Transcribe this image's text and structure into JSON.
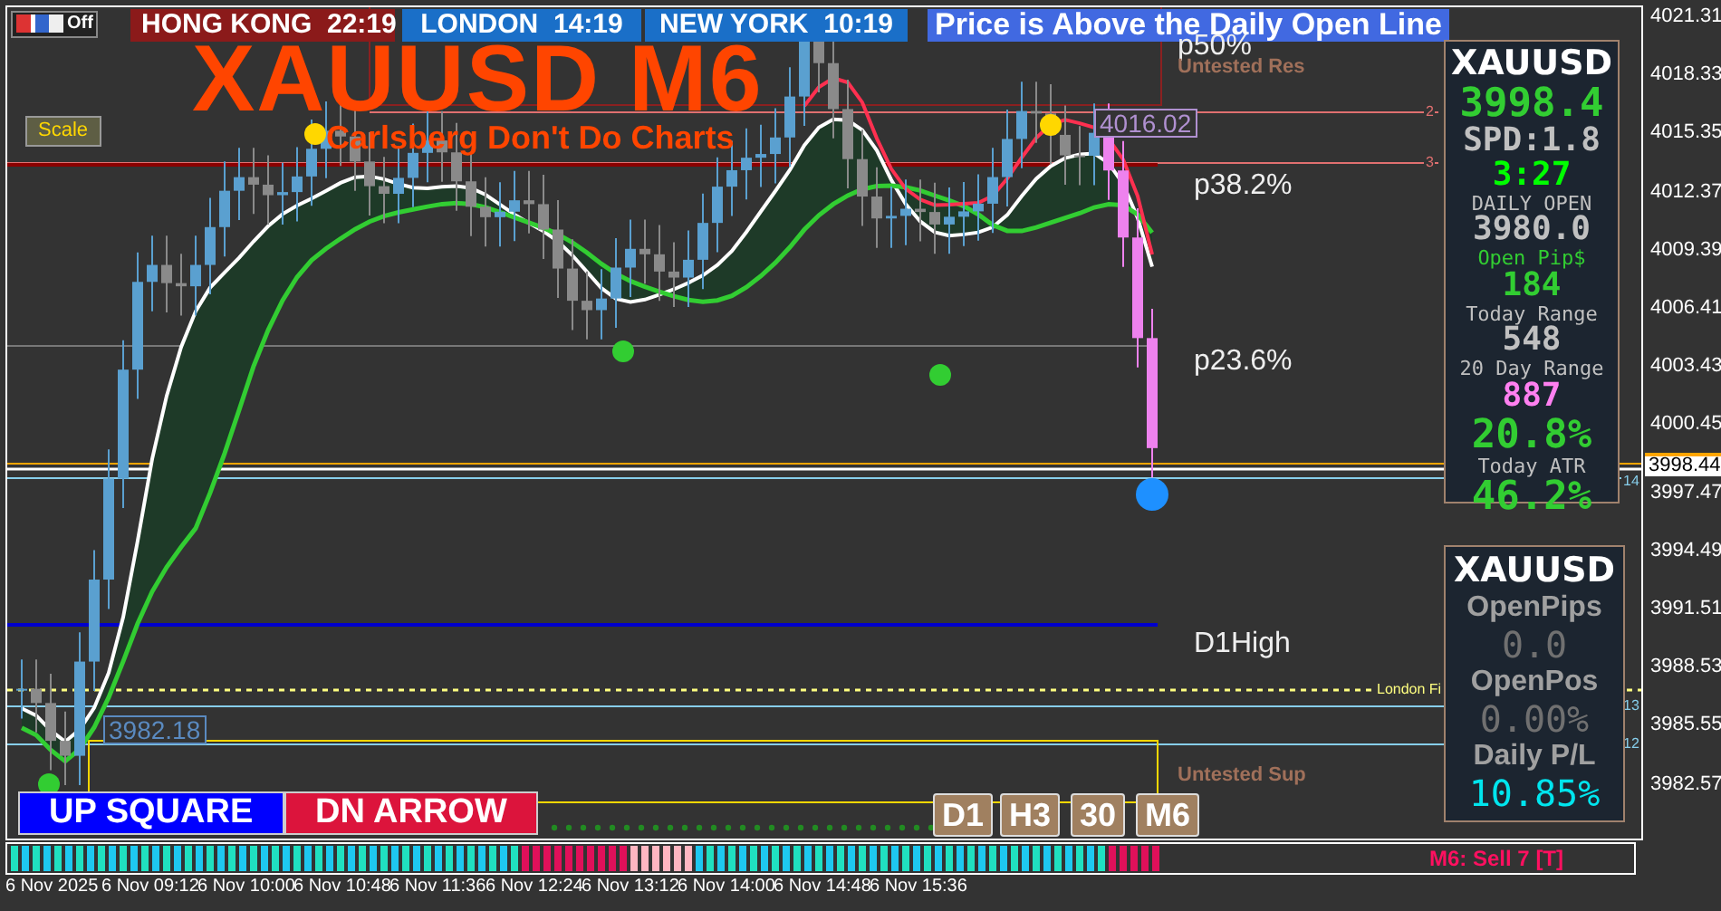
{
  "toolbar": {
    "label": "Off"
  },
  "clocks": [
    {
      "city": "HONG KONG",
      "time": "22:19",
      "color": "#8b1a1a"
    },
    {
      "city": "LONDON",
      "time": "14:19",
      "color": "#1a6fc8"
    },
    {
      "city": "NEW YORK",
      "time": "10:19",
      "color": "#1a6fc8"
    }
  ],
  "alert": "Price is Above the Daily Open Line",
  "chart": {
    "title": "XAUUSD M6",
    "subtitle": "Carlsberg Don't Do Charts",
    "scale_button": "Scale",
    "levels": [
      {
        "label": "p50%",
        "kind": "fib"
      },
      {
        "label": "Untested Res",
        "kind": "zone"
      },
      {
        "label": "p38.2%",
        "kind": "fib"
      },
      {
        "label": "p23.6%",
        "kind": "fib"
      },
      {
        "label": "D1High",
        "kind": "fib"
      },
      {
        "label": "Untested Sup",
        "kind": "zone"
      }
    ],
    "line_numbers": [
      "2",
      "3",
      "14",
      "13",
      "12"
    ],
    "line_note": "London Fi",
    "price_tags": [
      "4016.02",
      "3982.18"
    ]
  },
  "info_panel": {
    "rows": [
      {
        "text": "XAUUSD",
        "kind": "symbol",
        "color": "#ffffff"
      },
      {
        "text": "3998.4",
        "kind": "big",
        "color": "#32cd32"
      },
      {
        "text": "SPD:1.8",
        "kind": "value",
        "color": "#c0c0c0"
      },
      {
        "text": "3:27",
        "kind": "value",
        "color": "#00ff00"
      },
      {
        "text": "DAILY OPEN",
        "kind": "label",
        "color": "#c0c0c0"
      },
      {
        "text": "3980.0",
        "kind": "value",
        "color": "#c0c0c0"
      },
      {
        "text": "Open Pip$",
        "kind": "label",
        "color": "#32cd32"
      },
      {
        "text": "184",
        "kind": "value",
        "color": "#32cd32"
      },
      {
        "text": "Today Range",
        "kind": "label",
        "color": "#c0c0c0"
      },
      {
        "text": "548",
        "kind": "value",
        "color": "#c0c0c0"
      },
      {
        "text": "20 Day Range",
        "kind": "label",
        "color": "#c0c0c0"
      },
      {
        "text": "887",
        "kind": "value",
        "color": "#ff80f0"
      },
      {
        "text": "20.8%",
        "kind": "big",
        "color": "#32cd32"
      },
      {
        "text": "Today ATR",
        "kind": "label",
        "color": "#c0c0c0"
      },
      {
        "text": "46.2%",
        "kind": "big",
        "color": "#32cd32"
      }
    ]
  },
  "pl_panel": {
    "rows": [
      {
        "text": "XAUUSD",
        "kind": "symbol",
        "color": "#ffffff"
      },
      {
        "text": "OpenPips",
        "kind": "label",
        "color": "#a0a0a0"
      },
      {
        "text": "0.0",
        "kind": "digital",
        "color": "#707070"
      },
      {
        "text": "OpenPos",
        "kind": "label",
        "color": "#a0a0a0"
      },
      {
        "text": "0.00%",
        "kind": "digital",
        "color": "#707070"
      },
      {
        "text": "Daily P/L",
        "kind": "label",
        "color": "#a0a0a0"
      },
      {
        "text": "10.85%",
        "kind": "digital",
        "color": "#00e5ee"
      }
    ]
  },
  "signals": [
    {
      "label": "UP SQUARE",
      "color": "#0000ff"
    },
    {
      "label": "DN ARROW",
      "color": "#dc143c"
    }
  ],
  "timeframes": [
    "D1",
    "H3",
    "30",
    "M6"
  ],
  "status": "M6: Sell 7 [T]",
  "price_axis": {
    "labels": [
      "4021.31",
      "4018.33",
      "4015.35",
      "4012.37",
      "4009.39",
      "4006.41",
      "4003.43",
      "4000.45",
      "3997.47",
      "3994.49",
      "3991.51",
      "3988.53",
      "3985.55",
      "3982.57"
    ],
    "current": "3998.44"
  },
  "time_axis": [
    "6 Nov 2025",
    "6 Nov 09:12",
    "6 Nov 10:00",
    "6 Nov 10:48",
    "6 Nov 11:36",
    "6 Nov 12:24",
    "6 Nov 13:12",
    "6 Nov 14:00",
    "6 Nov 14:48",
    "6 Nov 15:36"
  ]
}
